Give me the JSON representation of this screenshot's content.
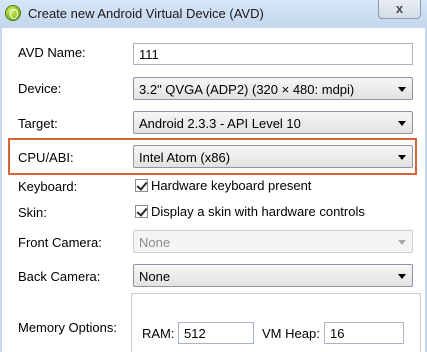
{
  "window": {
    "title": "Create new Android Virtual Device (AVD)",
    "close_label": "x"
  },
  "form": {
    "avd_name": {
      "label": "AVD Name:",
      "value": "111"
    },
    "device": {
      "label": "Device:",
      "value": "3.2\" QVGA (ADP2) (320 × 480: mdpi)"
    },
    "target": {
      "label": "Target:",
      "value": "Android 2.3.3 - API Level 10"
    },
    "cpu_abi": {
      "label": "CPU/ABI:",
      "value": "Intel Atom (x86)"
    },
    "keyboard": {
      "label": "Keyboard:",
      "checkbox_label": "Hardware keyboard present",
      "checked": true
    },
    "skin": {
      "label": "Skin:",
      "checkbox_label": "Display a skin with hardware controls",
      "checked": true
    },
    "front_camera": {
      "label": "Front Camera:",
      "value": "None",
      "disabled": true
    },
    "back_camera": {
      "label": "Back Camera:",
      "value": "None"
    },
    "memory_options": {
      "label": "Memory Options:",
      "ram_label": "RAM:",
      "ram_value": "512",
      "vm_heap_label": "VM Heap:",
      "vm_heap_value": "16"
    }
  },
  "colors": {
    "highlight_border": "#d9643c",
    "titlebar": "#c7d9ec"
  }
}
